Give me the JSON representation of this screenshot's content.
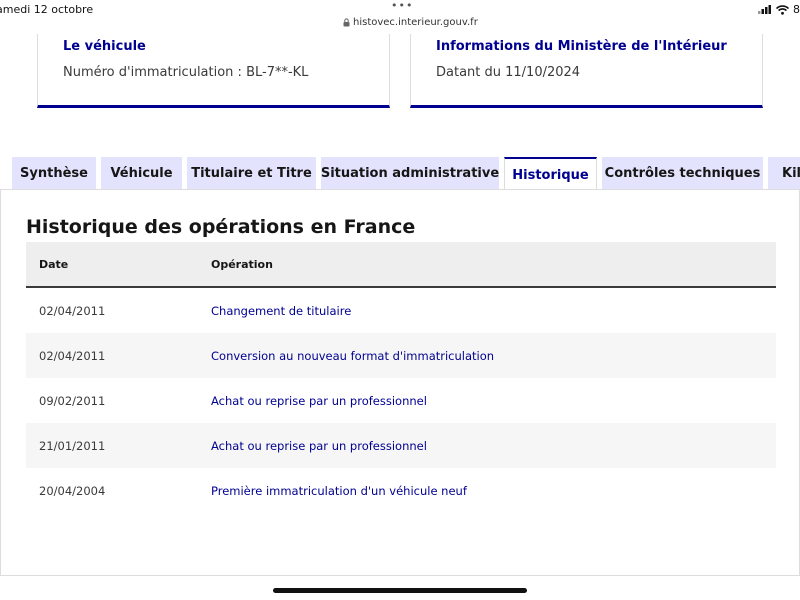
{
  "statusbar": {
    "date": "amedi 12 octobre",
    "url": "histovec.interieur.gouv.fr",
    "battery": "8"
  },
  "cards": {
    "vehicle": {
      "title": "Le véhicule",
      "text": "Numéro d'immatriculation : BL-7**-KL"
    },
    "ministry": {
      "title": "Informations du Ministère de l'Intérieur",
      "text": "Datant du 11/10/2024"
    }
  },
  "tabs": [
    {
      "label": "Synthèse"
    },
    {
      "label": "Véhicule"
    },
    {
      "label": "Titulaire et Titre"
    },
    {
      "label": "Situation administrative"
    },
    {
      "label": "Historique"
    },
    {
      "label": "Contrôles techniques"
    },
    {
      "label": "Kilo"
    }
  ],
  "active_tab": "Historique",
  "history": {
    "title": "Historique des opérations en France",
    "columns": {
      "date": "Date",
      "operation": "Opération"
    },
    "rows": [
      {
        "date": "02/04/2011",
        "operation": "Changement de titulaire"
      },
      {
        "date": "02/04/2011",
        "operation": "Conversion au nouveau format d'immatriculation"
      },
      {
        "date": "09/02/2011",
        "operation": "Achat ou reprise par un professionnel"
      },
      {
        "date": "21/01/2011",
        "operation": "Achat ou reprise par un professionnel"
      },
      {
        "date": "20/04/2004",
        "operation": "Première immatriculation d'un véhicule neuf"
      }
    ]
  },
  "colors": {
    "accent": "#000091",
    "tab_background": "#e3e3fd",
    "row_alt": "#f6f6f6"
  },
  "icons": [
    "lock-icon",
    "signal-icon",
    "wifi-icon",
    "more-dots-icon"
  ]
}
